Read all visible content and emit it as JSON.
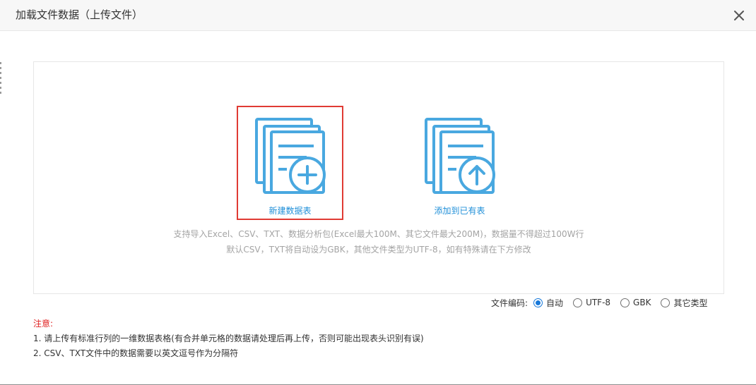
{
  "dialog": {
    "title": "加载文件数据（上传文件）",
    "close_icon": "close-icon"
  },
  "upload": {
    "options": [
      {
        "label": "新建数据表",
        "icon": "new-table-icon",
        "selected": true
      },
      {
        "label": "添加到已有表",
        "icon": "append-table-icon",
        "selected": false
      }
    ],
    "support_text": [
      "支持导入Excel、CSV、TXT、数据分析包(Excel最大100M、其它文件最大200M)，数据量不得超过100W行",
      "默认CSV，TXT将自动设为GBK，其他文件类型为UTF-8，如有特殊请在下方修改"
    ]
  },
  "encoding": {
    "label": "文件编码:",
    "options": [
      {
        "label": "自动",
        "checked": true
      },
      {
        "label": "UTF-8",
        "checked": false
      },
      {
        "label": "GBK",
        "checked": false
      },
      {
        "label": "其它类型",
        "checked": false
      }
    ]
  },
  "notes": {
    "title": "注意:",
    "items": [
      "1. 请上传有标准行列的一维数据表格(有合并单元格的数据请处理后再上传，否则可能出现表头识别有误)",
      "2. CSV、TXT文件中的数据需要以英文逗号作为分隔符"
    ]
  },
  "colors": {
    "accent": "#1f8fd8",
    "icon": "#49a8e0",
    "selection_border": "#e03b34",
    "warning": "#e02020",
    "muted_text": "#a4a4a4"
  }
}
